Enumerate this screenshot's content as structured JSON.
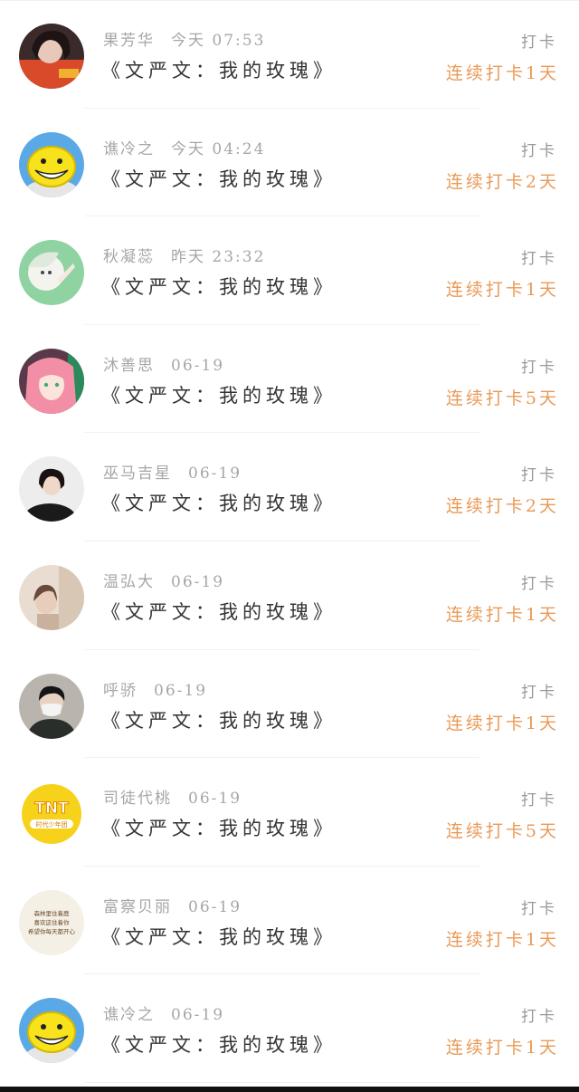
{
  "entries": [
    {
      "name": "果芳华",
      "time": "今天 07:53",
      "title": "《文严文：我的玫瑰》",
      "action": "打卡",
      "streak": "连续打卡1天",
      "avatar": "photo-girl-red"
    },
    {
      "name": "谯冷之",
      "time": "今天 04:24",
      "title": "《文严文：我的玫瑰》",
      "action": "打卡",
      "streak": "连续打卡2天",
      "avatar": "yellow-smiley"
    },
    {
      "name": "秋凝蕊",
      "time": "昨天 23:32",
      "title": "《文严文：我的玫瑰》",
      "action": "打卡",
      "streak": "连续打卡1天",
      "avatar": "anime-green"
    },
    {
      "name": "沐善思",
      "time": "06-19",
      "title": "《文严文：我的玫瑰》",
      "action": "打卡",
      "streak": "连续打卡5天",
      "avatar": "anime-pink-hair"
    },
    {
      "name": "巫马吉星",
      "time": "06-19",
      "title": "《文严文：我的玫瑰》",
      "action": "打卡",
      "streak": "连续打卡2天",
      "avatar": "photo-girl-dark"
    },
    {
      "name": "温弘大",
      "time": "06-19",
      "title": "《文严文：我的玫瑰》",
      "action": "打卡",
      "streak": "连续打卡1天",
      "avatar": "photo-beige"
    },
    {
      "name": "呼骄",
      "time": "06-19",
      "title": "《文严文：我的玫瑰》",
      "action": "打卡",
      "streak": "连续打卡1天",
      "avatar": "photo-mask"
    },
    {
      "name": "司徒代桃",
      "time": "06-19",
      "title": "《文严文：我的玫瑰》",
      "action": "打卡",
      "streak": "连续打卡5天",
      "avatar": "tnt-logo"
    },
    {
      "name": "富察贝丽",
      "time": "06-19",
      "title": "《文严文：我的玫瑰》",
      "action": "打卡",
      "streak": "连续打卡1天",
      "avatar": "handwriting-note"
    },
    {
      "name": "谯冷之",
      "time": "06-19",
      "title": "《文严文：我的玫瑰》",
      "action": "打卡",
      "streak": "连续打卡1天",
      "avatar": "yellow-smiley"
    }
  ],
  "avatar_texts": {
    "tnt": "TNT",
    "tnt_sub": "时代少年团",
    "note": [
      "森林里住着鹿",
      "喜欢这住着你",
      "希望你每天都开心"
    ]
  },
  "colors": {
    "streak": "#e99a57",
    "meta": "#a6a6a6",
    "title": "#333333",
    "action": "#999999"
  }
}
